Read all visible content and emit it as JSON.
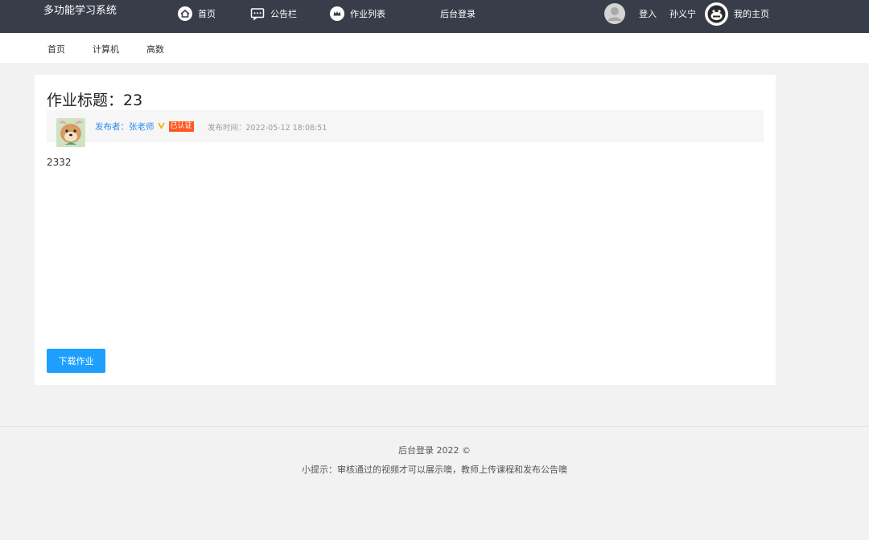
{
  "header": {
    "logo": "多功能学习系统",
    "nav": [
      {
        "label": "首页",
        "icon": "home-icon"
      },
      {
        "label": "公告栏",
        "icon": "chat-icon"
      },
      {
        "label": "作业列表",
        "icon": "crown-icon"
      },
      {
        "label": "后台登录",
        "icon": ""
      }
    ],
    "login_label": "登入",
    "user_name": "孙义宁",
    "homepage_label": "我的主页"
  },
  "subnav": {
    "tabs": [
      "首页",
      "计算机",
      "高数"
    ]
  },
  "assignment": {
    "title": "作业标题：23",
    "publisher_label": "发布者：张老师",
    "verified_badge": "已认证",
    "time_label": "发布时间：2022-05-12 18:08:51",
    "content": "2332",
    "download_label": "下载作业"
  },
  "footer": {
    "line1": "后台登录  2022 ©",
    "line2": "小提示：审核通过的视频才可以展示噢，教师上传课程和发布公告噢"
  },
  "colors": {
    "topbar": "#393d49",
    "accent": "#1e9fff",
    "badge": "#ff5722",
    "link": "#2d8cf0"
  }
}
